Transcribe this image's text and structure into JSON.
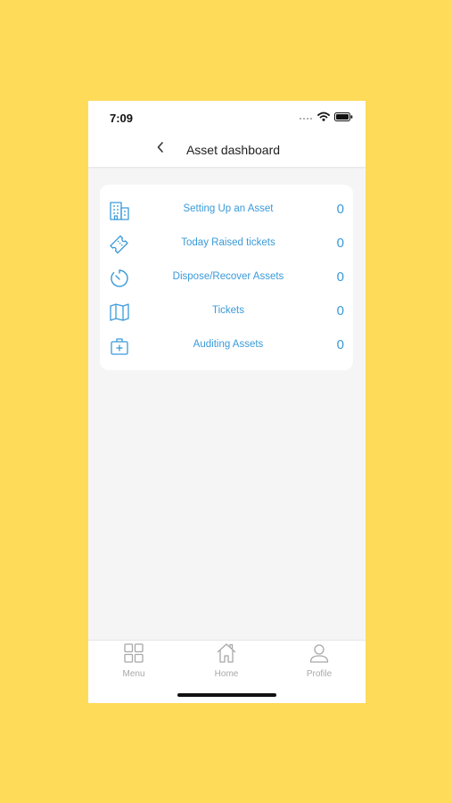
{
  "status_bar": {
    "time": "7:09"
  },
  "header": {
    "title": "Asset dashboard"
  },
  "dashboard": {
    "items": [
      {
        "label": "Setting Up an Asset",
        "count": "0",
        "icon": "building-icon"
      },
      {
        "label": "Today Raised tickets",
        "count": "0",
        "icon": "ticket-icon"
      },
      {
        "label": "Dispose/Recover Assets",
        "count": "0",
        "icon": "timer-icon"
      },
      {
        "label": "Tickets",
        "count": "0",
        "icon": "map-icon"
      },
      {
        "label": "Auditing Assets",
        "count": "0",
        "icon": "medical-bag-icon"
      }
    ]
  },
  "tabbar": {
    "tabs": [
      {
        "label": "Menu",
        "icon": "grid-icon"
      },
      {
        "label": "Home",
        "icon": "home-icon"
      },
      {
        "label": "Profile",
        "icon": "user-icon"
      }
    ]
  },
  "colors": {
    "background": "#FFDB5A",
    "accent": "#3A9AD9",
    "tab_inactive": "#A8A8A8"
  }
}
